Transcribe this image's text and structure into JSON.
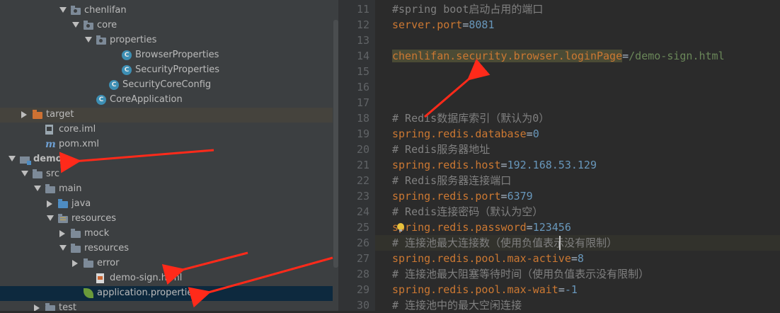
{
  "tree": {
    "items": [
      {
        "label": "chenlifan",
        "depth": 5,
        "arrow": "down",
        "icon": "package",
        "state": ""
      },
      {
        "label": "core",
        "depth": 6,
        "arrow": "down",
        "icon": "package",
        "state": ""
      },
      {
        "label": "properties",
        "depth": 7,
        "arrow": "down",
        "icon": "package",
        "state": ""
      },
      {
        "label": "BrowserProperties",
        "depth": 9,
        "arrow": "",
        "icon": "class",
        "state": ""
      },
      {
        "label": "SecurityProperties",
        "depth": 9,
        "arrow": "",
        "icon": "class",
        "state": ""
      },
      {
        "label": "SecurityCoreConfig",
        "depth": 8,
        "arrow": "",
        "icon": "class",
        "state": ""
      },
      {
        "label": "CoreApplication",
        "depth": 7,
        "arrow": "",
        "icon": "class-run",
        "state": ""
      },
      {
        "label": "target",
        "depth": 2,
        "arrow": "right",
        "icon": "folder-orange",
        "state": "band"
      },
      {
        "label": "core.iml",
        "depth": 3,
        "arrow": "",
        "icon": "file",
        "state": ""
      },
      {
        "label": "pom.xml",
        "depth": 3,
        "arrow": "",
        "icon": "maven",
        "state": ""
      },
      {
        "label": "demo",
        "depth": 1,
        "arrow": "down",
        "icon": "module",
        "state": "bold"
      },
      {
        "label": "src",
        "depth": 2,
        "arrow": "down",
        "icon": "folder",
        "state": ""
      },
      {
        "label": "main",
        "depth": 3,
        "arrow": "down",
        "icon": "folder",
        "state": ""
      },
      {
        "label": "java",
        "depth": 4,
        "arrow": "right",
        "icon": "folder-blue",
        "state": ""
      },
      {
        "label": "resources",
        "depth": 4,
        "arrow": "down",
        "icon": "folder-res",
        "state": ""
      },
      {
        "label": "mock",
        "depth": 5,
        "arrow": "right",
        "icon": "folder",
        "state": ""
      },
      {
        "label": "resources",
        "depth": 5,
        "arrow": "down",
        "icon": "folder",
        "state": ""
      },
      {
        "label": "error",
        "depth": 6,
        "arrow": "right",
        "icon": "folder",
        "state": ""
      },
      {
        "label": "demo-sign.html",
        "depth": 7,
        "arrow": "",
        "icon": "html",
        "state": ""
      },
      {
        "label": "application.properties",
        "depth": 6,
        "arrow": "",
        "icon": "properties",
        "state": "sel"
      },
      {
        "label": "test",
        "depth": 3,
        "arrow": "right",
        "icon": "folder",
        "state": ""
      }
    ]
  },
  "editor": {
    "lines": [
      {
        "num": "11",
        "parts": [
          [
            "c",
            "#spring boot启动占用的端口"
          ]
        ]
      },
      {
        "num": "12",
        "parts": [
          [
            "k",
            "server.port"
          ],
          [
            "eq",
            "="
          ],
          [
            "n",
            "8081"
          ]
        ]
      },
      {
        "num": "13",
        "parts": []
      },
      {
        "num": "14",
        "parts": [
          [
            "kh",
            "chenlifan.security.browser.loginPage"
          ],
          [
            "eq",
            "="
          ],
          [
            "v",
            "/demo-sign.html"
          ]
        ]
      },
      {
        "num": "15",
        "parts": []
      },
      {
        "num": "16",
        "parts": []
      },
      {
        "num": "17",
        "parts": []
      },
      {
        "num": "18",
        "parts": [
          [
            "c",
            "# Redis数据库索引（默认为0）"
          ]
        ]
      },
      {
        "num": "19",
        "parts": [
          [
            "k",
            "spring.redis.database"
          ],
          [
            "eq",
            "="
          ],
          [
            "n",
            "0"
          ]
        ]
      },
      {
        "num": "20",
        "parts": [
          [
            "c",
            "# Redis服务器地址"
          ]
        ]
      },
      {
        "num": "21",
        "parts": [
          [
            "k",
            "spring.redis.host"
          ],
          [
            "eq",
            "="
          ],
          [
            "n",
            "192.168.53.129"
          ]
        ]
      },
      {
        "num": "22",
        "parts": [
          [
            "c",
            "# Redis服务器连接端口"
          ]
        ]
      },
      {
        "num": "23",
        "parts": [
          [
            "k",
            "spring.redis.port"
          ],
          [
            "eq",
            "="
          ],
          [
            "n",
            "6379"
          ]
        ]
      },
      {
        "num": "24",
        "parts": [
          [
            "c",
            "# Redis连接密码（默认为空）"
          ]
        ]
      },
      {
        "num": "25",
        "parts": [
          [
            "k",
            "spring.redis.password"
          ],
          [
            "eq",
            "="
          ],
          [
            "n",
            "123456"
          ]
        ]
      },
      {
        "num": "26",
        "parts": [
          [
            "c",
            "# 连接池最大连接数（使用负值表示没有限制）"
          ]
        ]
      },
      {
        "num": "27",
        "parts": [
          [
            "k",
            "spring.redis.pool.max-active"
          ],
          [
            "eq",
            "="
          ],
          [
            "n",
            "8"
          ]
        ]
      },
      {
        "num": "28",
        "parts": [
          [
            "c",
            "# 连接池最大阻塞等待时间（使用负值表示没有限制）"
          ]
        ]
      },
      {
        "num": "29",
        "parts": [
          [
            "k",
            "spring.redis.pool.max-wait"
          ],
          [
            "eq",
            "="
          ],
          [
            "n",
            "-1"
          ]
        ]
      },
      {
        "num": "30",
        "parts": [
          [
            "c",
            "# 连接池中的最大空闲连接"
          ]
        ]
      }
    ]
  },
  "colors": {
    "annotation_arrow": "#ff2a1a",
    "key": "#cc7832",
    "number": "#6897bb",
    "string": "#6a8759",
    "comment": "#808080"
  }
}
